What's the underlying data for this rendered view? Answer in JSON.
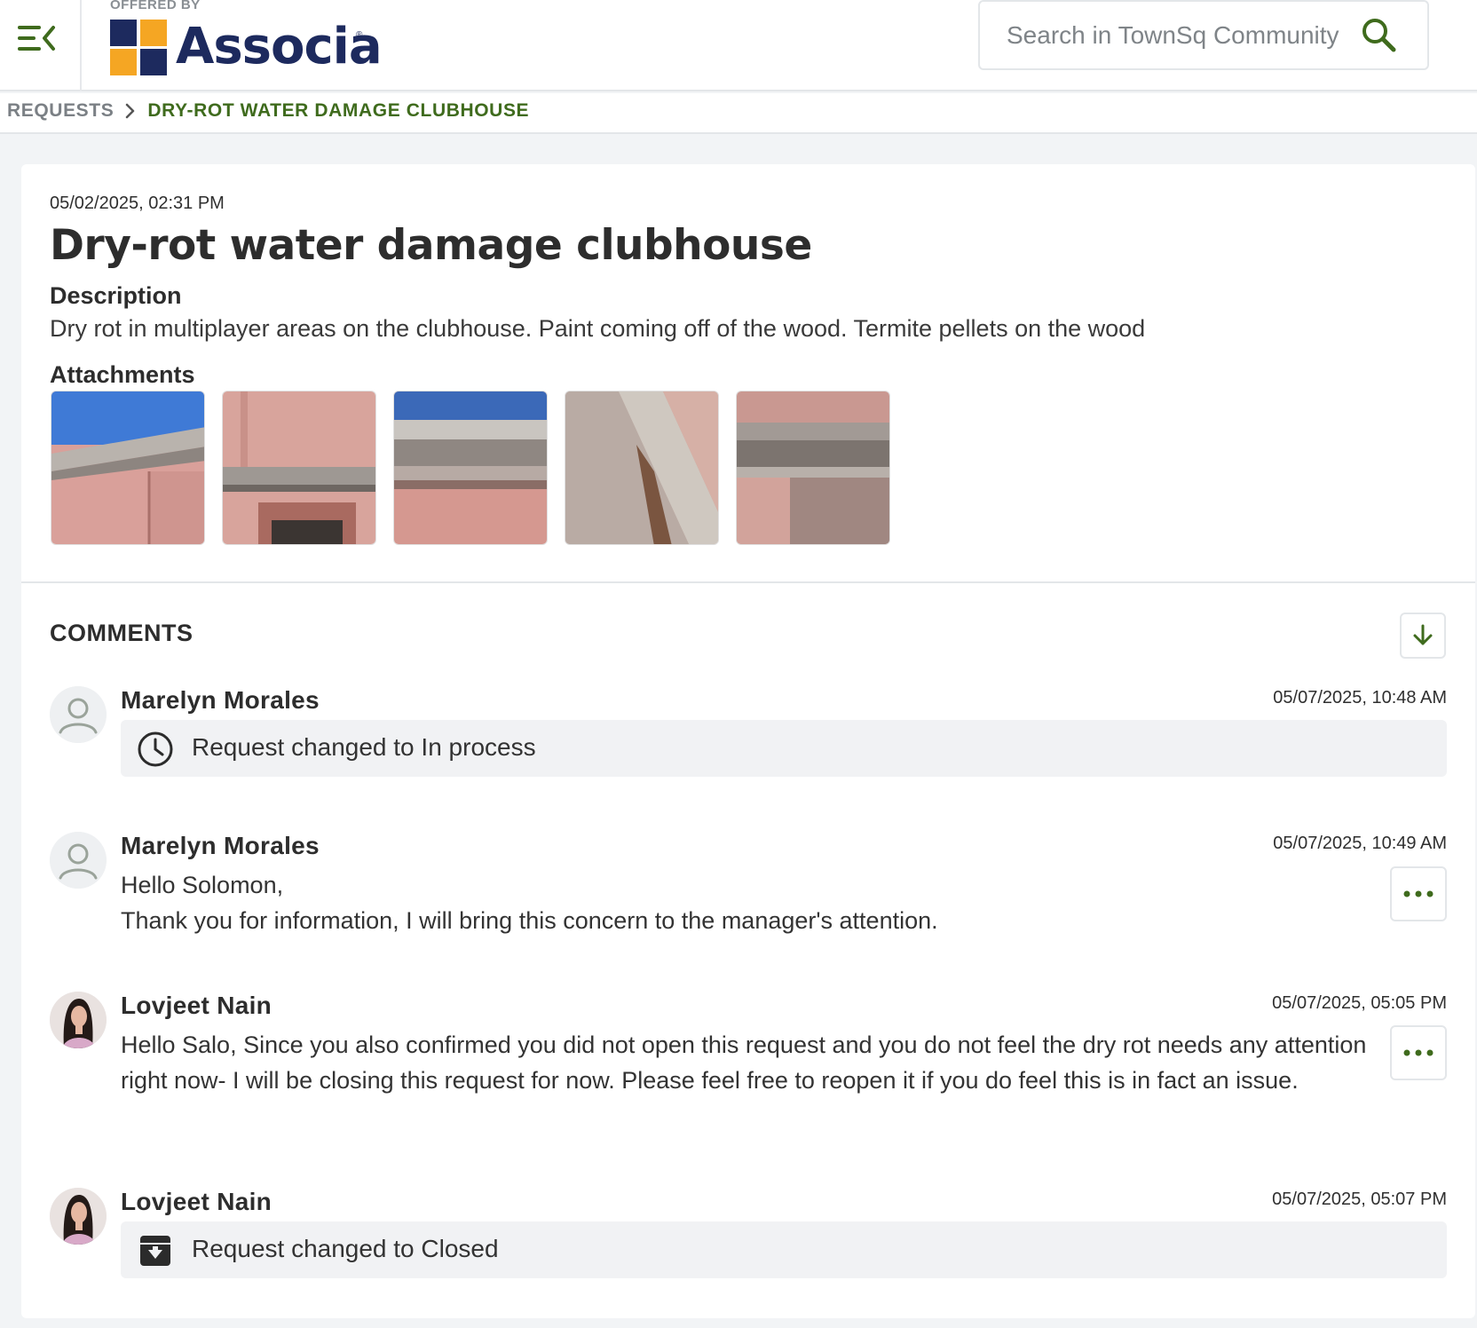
{
  "header": {
    "offered_by": "OFFERED BY",
    "logo_text": "Associa",
    "logo_reg": "®",
    "search_placeholder": "Search in TownSq Community"
  },
  "breadcrumb": {
    "parent": "REQUESTS",
    "current": "DRY-ROT WATER DAMAGE CLUBHOUSE"
  },
  "request": {
    "created_at": "05/02/2025, 02:31 PM",
    "title": "Dry-rot water damage clubhouse",
    "description_label": "Description",
    "description": "Dry rot in multiplayer areas on the clubhouse. Paint coming off of the wood. Termite pellets on the wood",
    "attachments_label": "Attachments",
    "attachments": [
      {
        "name": "attachment-1"
      },
      {
        "name": "attachment-2"
      },
      {
        "name": "attachment-3"
      },
      {
        "name": "attachment-4"
      },
      {
        "name": "attachment-5"
      }
    ]
  },
  "comments": {
    "title": "COMMENTS",
    "items": [
      {
        "author": "Marelyn Morales",
        "timestamp": "05/07/2025, 10:48 AM",
        "type": "status",
        "status_icon": "clock-icon",
        "text": "Request changed to In process"
      },
      {
        "author": "Marelyn Morales",
        "timestamp": "05/07/2025, 10:49 AM",
        "type": "message",
        "lines": [
          "Hello Solomon,",
          "Thank you for information, I will bring this concern to the manager's attention."
        ]
      },
      {
        "author": "Lovjeet Nain",
        "timestamp": "05/07/2025, 05:05 PM",
        "type": "message",
        "lines": [
          "Hello Salo, Since you also confirmed you did not open this request and you do not feel the dry rot needs any attention right now- I will be closing this request for now.  Please feel free to reopen it if you do feel this is in fact an issue."
        ]
      },
      {
        "author": "Lovjeet Nain",
        "timestamp": "05/07/2025, 05:07 PM",
        "type": "status",
        "status_icon": "archive-icon",
        "text": "Request changed to Closed"
      }
    ]
  },
  "colors": {
    "accent_green": "#3f6b1d",
    "logo_navy": "#1d2a5e",
    "logo_orange": "#f5a623"
  }
}
